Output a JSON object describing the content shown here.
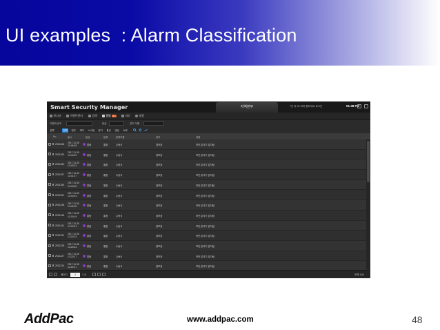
{
  "slide": {
    "title": "UI examples  : Alarm Classification",
    "footer_logo": "AddPac",
    "footer_url": "www.addpac.com",
    "page_number": "48",
    "header_gradient": [
      "#06069c",
      "#ffffff"
    ]
  },
  "app": {
    "name": "Smart Security Manager",
    "region_tab": "지역본부",
    "status_text": "7인 외 30 여러 원하세요 로그인",
    "clock": "01:48 PM",
    "menu": [
      {
        "label": "모니터",
        "icon": "monitor-icon"
      },
      {
        "label": "이벤트관리",
        "icon": "event-icon"
      },
      {
        "label": "검색",
        "icon": "search-icon"
      },
      {
        "label": "알람",
        "icon": "bell-icon",
        "badge": "99+",
        "active": true
      },
      {
        "label": "지도",
        "icon": "map-icon"
      },
      {
        "label": "설정",
        "icon": "gear-icon"
      }
    ],
    "filters": [
      {
        "label": "이벤트검색"
      },
      {
        "label": "등급"
      },
      {
        "label": "장치 이름"
      }
    ],
    "category_label": "분류",
    "categories": [
      {
        "label": "전체",
        "active": true
      },
      {
        "label": "일반"
      },
      {
        "label": "제어"
      },
      {
        "label": "시스템"
      },
      {
        "label": "장치"
      },
      {
        "label": "통신"
      },
      {
        "label": "영상"
      },
      {
        "label": "녹화"
      }
    ],
    "columns": [
      "No",
      "일시",
      "등급",
      "분류",
      "분류이름",
      "장치",
      "내용"
    ],
    "rows": [
      {
        "no": "2921266",
        "date": "2017.11.30",
        "time": "13:46:48",
        "level": "알람",
        "cat": "통합",
        "type": "수동식",
        "device": "경보장",
        "desc": "보안 분석기 감지됨"
      },
      {
        "no": "2921263",
        "date": "2017.11.30",
        "time": "13:43:29",
        "level": "알람",
        "cat": "통합",
        "type": "수동식",
        "device": "경보장",
        "desc": "보안 분석기 감지됨"
      },
      {
        "no": "2921260",
        "date": "2017.11.30",
        "time": "13:43:23",
        "level": "알람",
        "cat": "통합",
        "type": "수동식",
        "device": "경보장",
        "desc": "보안 분석기 감지됨"
      },
      {
        "no": "2921257",
        "date": "2017.11.30",
        "time": "13:41:37",
        "level": "알람",
        "cat": "통합",
        "type": "수동식",
        "device": "경보장",
        "desc": "보안 분석기 감지됨"
      },
      {
        "no": "2921254",
        "date": "2017.11.30",
        "time": "13:40:35",
        "level": "알람",
        "cat": "통합",
        "type": "수동식",
        "device": "경보장",
        "desc": "보안 분석기 감지됨"
      },
      {
        "no": "2921251",
        "date": "2017.11.30",
        "time": "13:40:04",
        "level": "알람",
        "cat": "통합",
        "type": "수동식",
        "device": "경보장",
        "desc": "보안 분석기 감지됨"
      },
      {
        "no": "2921248",
        "date": "2017.11.30",
        "time": "13:40:09",
        "level": "알람",
        "cat": "통합",
        "type": "수동식",
        "device": "경보장",
        "desc": "보안 분석기 감지됨"
      },
      {
        "no": "2921245",
        "date": "2017.11.30",
        "time": "13:30:15",
        "level": "알람",
        "cat": "통합",
        "type": "수동식",
        "device": "경보장",
        "desc": "보안 분석기 감지됨"
      },
      {
        "no": "2921241",
        "date": "2017.11.30",
        "time": "13:23:24",
        "level": "알람",
        "cat": "통합",
        "type": "수동식",
        "device": "경보장",
        "desc": "보안 분석기 감지됨"
      },
      {
        "no": "2921231",
        "date": "2017.11.30",
        "time": "13:20:24",
        "level": "알람",
        "cat": "통합",
        "type": "수동식",
        "device": "경보장",
        "desc": "보안 분석기 감지됨"
      },
      {
        "no": "2921228",
        "date": "2017.11.30",
        "time": "13:23:44",
        "level": "알람",
        "cat": "통합",
        "type": "수동식",
        "device": "경보장",
        "desc": "보안 분석기 감지됨"
      },
      {
        "no": "2921227",
        "date": "2017.11.30",
        "time": "13:23:17",
        "level": "알람",
        "cat": "통합",
        "type": "수동식",
        "device": "경보장",
        "desc": "보안 분석기 감지됨"
      },
      {
        "no": "2921224",
        "date": "2017.11.30",
        "time": "13:22:47",
        "level": "알람",
        "cat": "통합",
        "type": "수동식",
        "device": "경보장",
        "desc": "보안 분석기 감지됨"
      }
    ],
    "pager": {
      "prefix": "페이지",
      "current": "1",
      "total_text": "/ 10",
      "count_text": "전체 100"
    },
    "severity_color": "#8b38c9",
    "accent_color": "#2e86d6"
  }
}
